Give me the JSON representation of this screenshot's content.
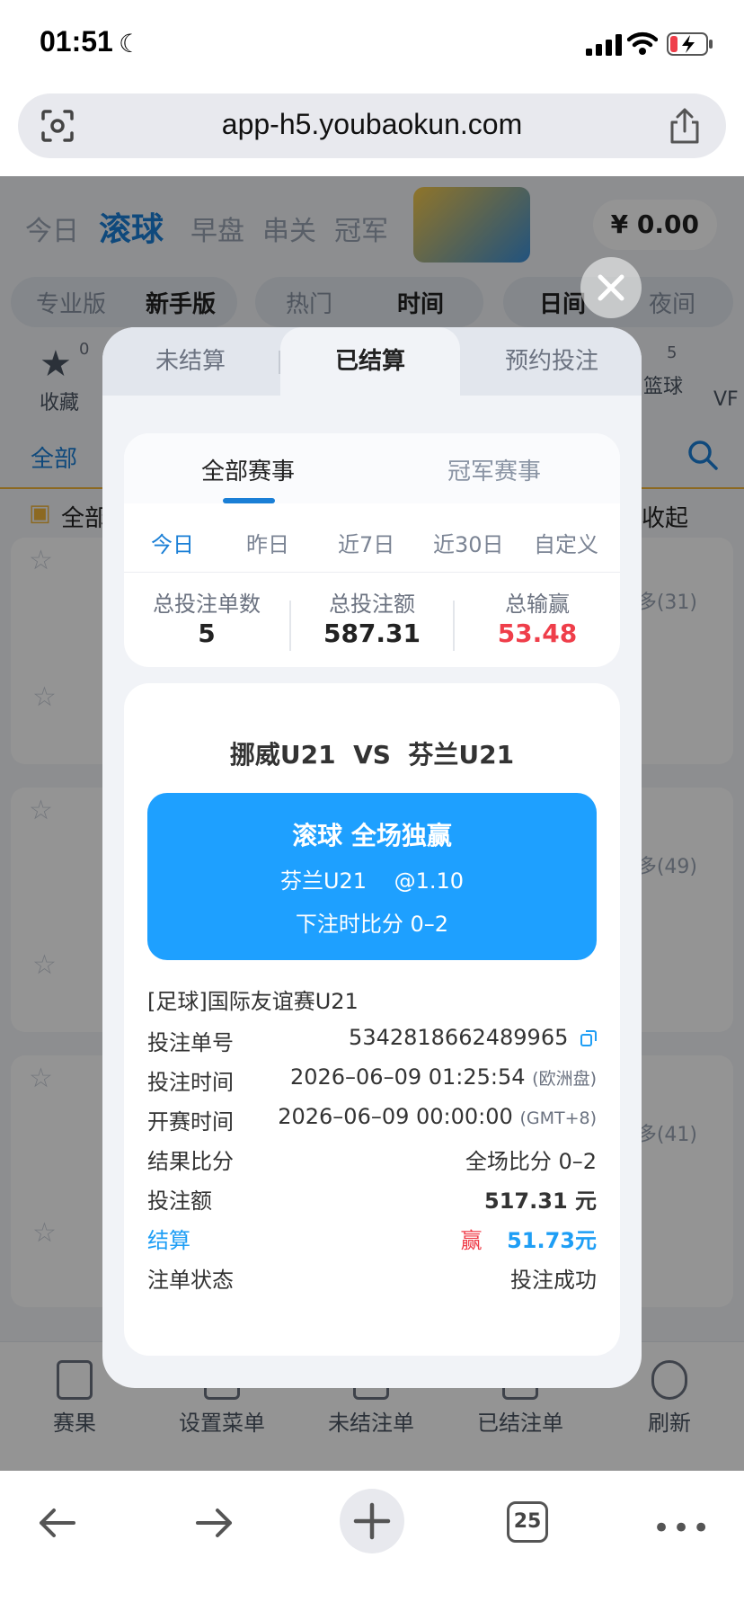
{
  "status_bar": {
    "time": "01:51"
  },
  "browser": {
    "url": "app-h5.youbaokun.com",
    "tab_count": "25"
  },
  "background_page": {
    "top_tabs": [
      "今日",
      "滚球",
      "早盘",
      "串关",
      "冠军"
    ],
    "balance": "¥ 0.00",
    "mode_pills": [
      "专业版",
      "新手版"
    ],
    "sort_pills": [
      "热门",
      "时间"
    ],
    "theme_pills": [
      "日间",
      "夜间"
    ],
    "favorites_label": "收藏",
    "favorites_count": "0",
    "basketball_label": "篮球",
    "basketball_count": "5",
    "vf_label": "VF",
    "filter_all": "全部",
    "section_all": "全部",
    "collapse_label": "收起",
    "more_counts": [
      "多(31)",
      "多(49)",
      "多(41)"
    ],
    "bottom_nav": [
      "赛果",
      "设置菜单",
      "未结注单",
      "已结注单",
      "刷新"
    ]
  },
  "modal": {
    "tabs": [
      "未结算",
      "已结算",
      "预约投注"
    ],
    "active_tab": 1,
    "sub_tabs": [
      "全部赛事",
      "冠军赛事"
    ],
    "date_tabs": [
      "今日",
      "昨日",
      "近7日",
      "近30日",
      "自定义"
    ],
    "stats": [
      {
        "label": "总投注单数",
        "value": "5"
      },
      {
        "label": "总投注额",
        "value": "587.31"
      },
      {
        "label": "总输赢",
        "value": "53.48"
      }
    ],
    "bet": {
      "match": "挪威U21  VS  芬兰U21",
      "type": "滚球 全场独赢",
      "pick": "芬兰U21    @1.10",
      "score_at_bet": "下注时比分 0–2",
      "league": "[足球]国际友谊赛U21",
      "order_no_label": "投注单号",
      "order_no": "5342818662489965",
      "bet_time_label": "投注时间",
      "bet_time": "2026–06–09 01:25:54",
      "bet_time_note": "(欧洲盘)",
      "start_time_label": "开赛时间",
      "start_time": "2026–06–09 00:00:00",
      "start_time_note": "(GMT+8)",
      "result_label": "结果比分",
      "result": "全场比分 0–2",
      "amount_label": "投注额",
      "amount": "517.31 元",
      "settle_label": "结算",
      "settle_result": "赢",
      "settle_amount": "51.73元",
      "status_label": "注单状态",
      "status": "投注成功"
    }
  },
  "colors": {
    "accent": "#1ea0ff",
    "win_red": "#ef3e4a",
    "tab_blue": "#1a7fd6"
  }
}
